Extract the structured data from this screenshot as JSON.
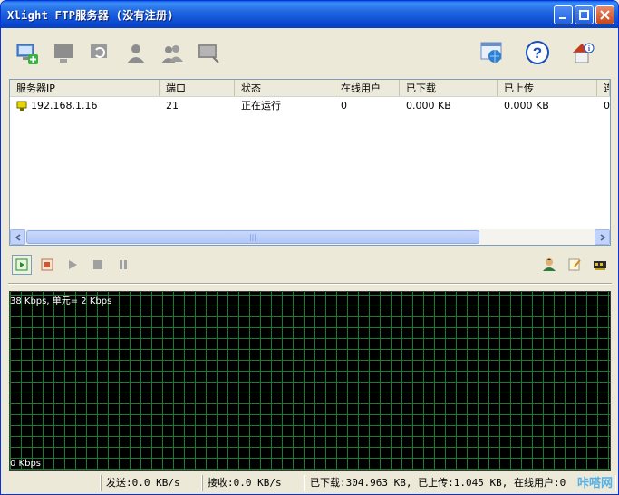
{
  "window": {
    "title": "Xlight FTP服务器 (没有注册)",
    "min_label": "_",
    "max_label": "□",
    "close_label": "✕"
  },
  "toolbar": {
    "icons": [
      "add-server-icon",
      "server-icon",
      "server-refresh-icon",
      "user-icon",
      "users-icon",
      "screen-icon"
    ],
    "right_icons": [
      "globe-window-icon",
      "help-icon",
      "info-home-icon"
    ]
  },
  "grid": {
    "columns": [
      "服务器IP",
      "端口",
      "状态",
      "在线用户",
      "已下载",
      "已上传",
      "连"
    ],
    "rows": [
      {
        "ip": "192.168.1.16",
        "port": "21",
        "status": "正在运行",
        "online": "0",
        "downloaded": "0.000 KB",
        "uploaded": "0.000 KB",
        "more": "0"
      }
    ],
    "scroll_grip": "|||"
  },
  "graph": {
    "top_label": "38 Kbps, 单元= 2 Kbps",
    "bottom_label": "0 Kbps"
  },
  "status": {
    "send": "发送:0.0 KB/s",
    "recv": "接收:0.0 KB/s",
    "totals": "已下载:304.963 KB, 已上传:1.045 KB, 在线用户:0"
  },
  "watermark": "咔嗒网"
}
